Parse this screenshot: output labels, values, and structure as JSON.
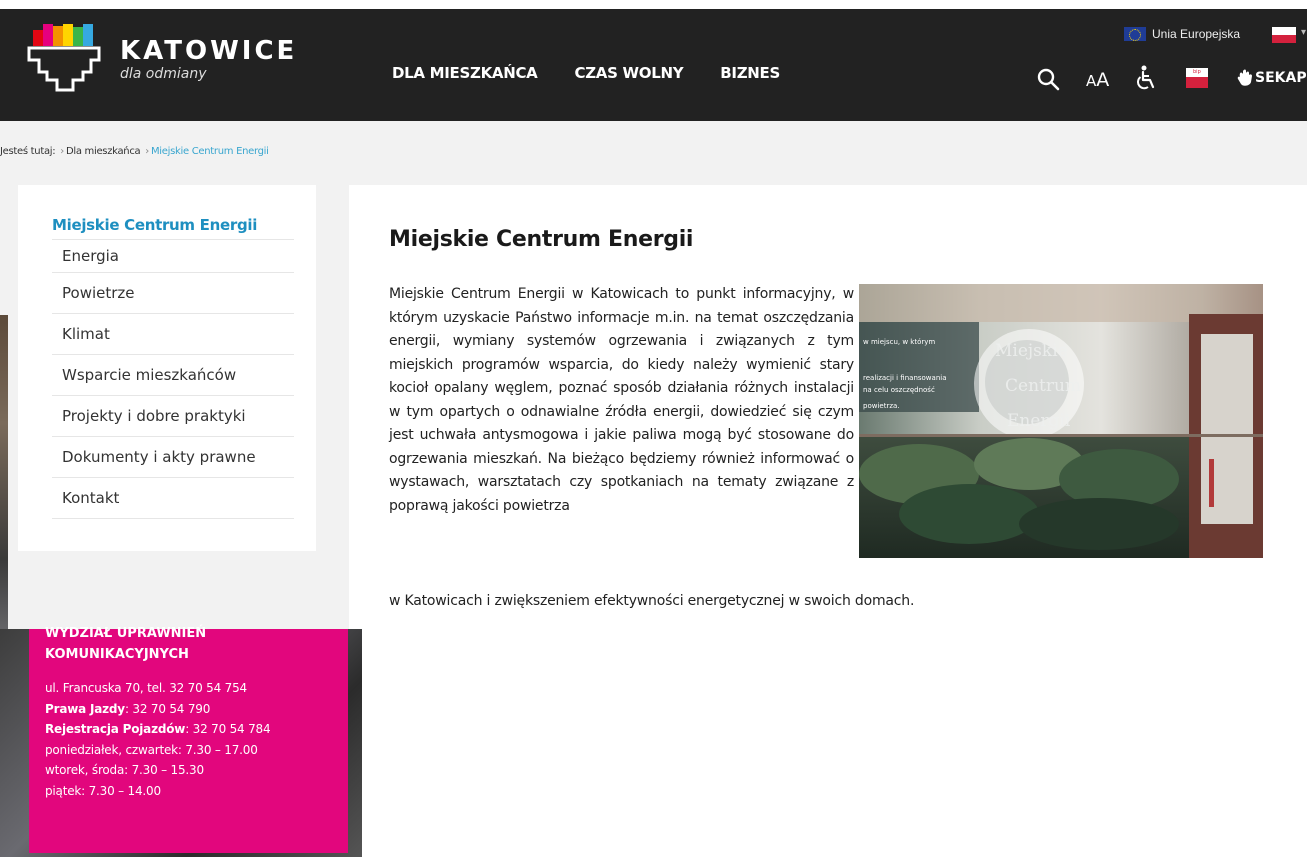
{
  "header": {
    "brand_name": "KATOWICE",
    "brand_sub": "dla odmiany",
    "nav": [
      "DLA MIESZKAŃCA",
      "CZAS WOLNY",
      "BIZNES"
    ],
    "eu_label": "Unia Europejska",
    "font_size_label_small": "A",
    "font_size_label_big": "A",
    "bip_label": "bip",
    "sekap_label": "SEKAP"
  },
  "breadcrumb": {
    "prefix": "Jesteś tutaj:",
    "items": [
      "Dla mieszkańca",
      "Miejskie Centrum Energii"
    ]
  },
  "sidebar": {
    "title": "Miejskie Centrum Energii",
    "items": [
      "Energia",
      "Powietrze",
      "Klimat",
      "Wsparcie mieszkańców",
      "Projekty i dobre praktyki",
      "Dokumenty i akty prawne",
      "Kontakt"
    ]
  },
  "contact": {
    "title": "WYDZIAŁ UPRAWNIEŃ KOMUNIKACYJNYCH",
    "address": "ul. Francuska 70, tel. 32 70 54 754",
    "license_label": "Prawa Jazdy",
    "license_phone": ": 32 70 54 790",
    "registration_label": "Rejestracja Pojazdów",
    "registration_phone": ": 32 70 54 784",
    "hours": [
      "poniedziałek, czwartek: 7.30 – 17.00",
      "wtorek, środa: 7.30 – 15.30",
      "piątek: 7.30 – 14.00"
    ]
  },
  "main": {
    "title": "Miejskie Centrum Energii",
    "body": "Miejskie Centrum Energii w Katowicach to punkt informacyjny, w którym uzyskacie Państwo informacje m.in. na temat oszczędzania energii, wymiany systemów ogrzewania i związanych z tym miejskich programów wsparcia, do kiedy należy wymienić stary kocioł opalany węglem, poznać sposób działania różnych instalacji w tym opartych o odnawialne źródła energii, dowiedzieć się czym jest uchwała antysmogowa i jakie paliwa mogą być stosowane do ogrzewania mieszkań. Na bieżąco będziemy również informować o wystawach, warsztatach czy spotkaniach na tematy związane z poprawą jakości powietrza",
    "body_last": "w Katowicach i zwiększeniem efektywności energetycznej w swoich domach.",
    "photo_sign": [
      "Miejskie",
      "Centrum",
      "Energii"
    ],
    "photo_window_text": [
      "w miejscu, w którym",
      "realizacji i finansowania",
      "na celu oszczędność",
      "powietrza."
    ]
  },
  "colors": {
    "header_bg": "#222222",
    "accent_blue": "#1e8fc0",
    "contact_pink": "#e2067d"
  }
}
